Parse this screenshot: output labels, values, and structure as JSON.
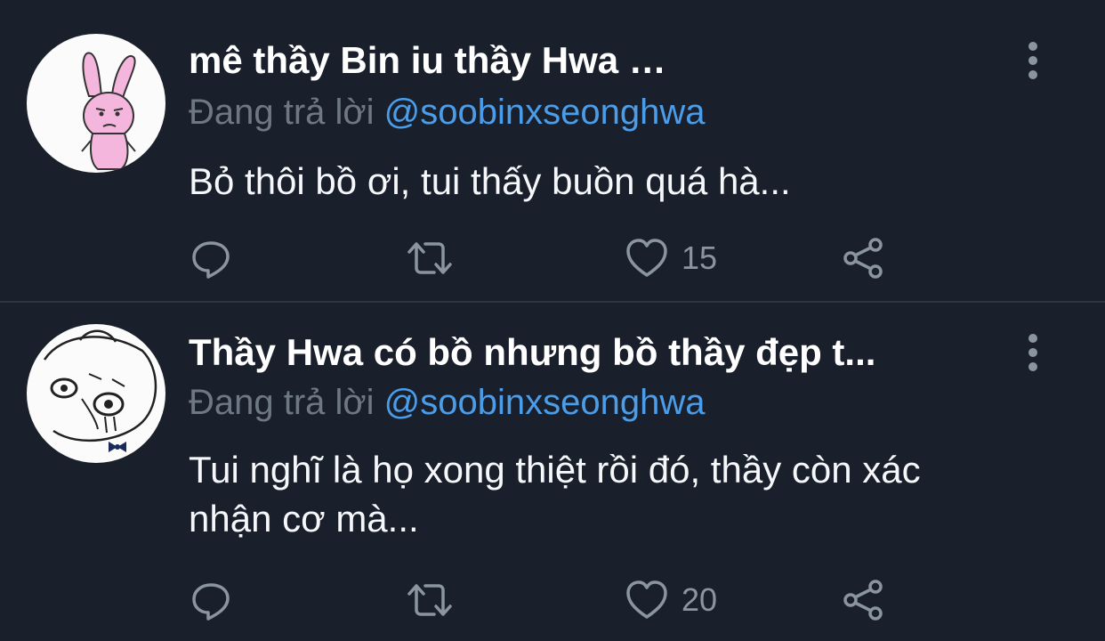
{
  "tweets": [
    {
      "author": "mê thầy Bin iu thầy Hwa …",
      "reply_prefix": "Đang trả lời",
      "reply_handle": "@soobinxseonghwa",
      "text": "Bỏ thôi bồ ơi, tui thấy buồn quá hà...",
      "likes": "15",
      "avatar": "pink-bunny-avatar"
    },
    {
      "author": "Thầy Hwa có bồ nhưng bồ thầy đẹp t...",
      "reply_prefix": "Đang trả lời",
      "reply_handle": "@soobinxseonghwa",
      "text": "Tui nghĩ là họ xong thiệt rồi đó, thầy còn xác nhận cơ mà...",
      "likes": "20",
      "avatar": "crying-sketch-avatar"
    }
  ],
  "icons": [
    "reply-icon",
    "retweet-icon",
    "heart-icon",
    "share-icon",
    "more-options-icon"
  ],
  "colors": {
    "background": "#1a202b",
    "handle": "#4b9de9",
    "secondary_text": "#6e7884",
    "icon": "#8a95a1"
  }
}
